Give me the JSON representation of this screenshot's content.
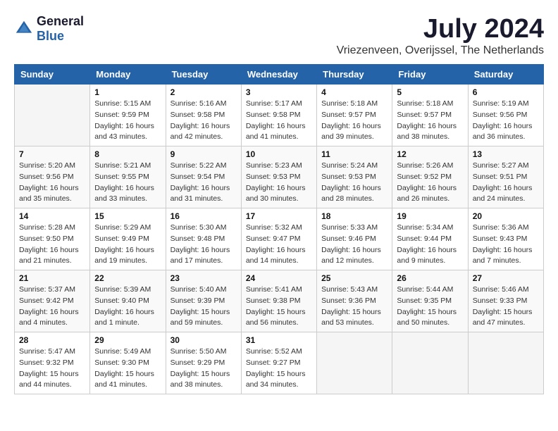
{
  "header": {
    "logo_general": "General",
    "logo_blue": "Blue",
    "title": "July 2024",
    "subtitle": "Vriezenveen, Overijssel, The Netherlands"
  },
  "weekdays": [
    "Sunday",
    "Monday",
    "Tuesday",
    "Wednesday",
    "Thursday",
    "Friday",
    "Saturday"
  ],
  "weeks": [
    [
      {
        "day": "",
        "info": ""
      },
      {
        "day": "1",
        "info": "Sunrise: 5:15 AM\nSunset: 9:59 PM\nDaylight: 16 hours\nand 43 minutes."
      },
      {
        "day": "2",
        "info": "Sunrise: 5:16 AM\nSunset: 9:58 PM\nDaylight: 16 hours\nand 42 minutes."
      },
      {
        "day": "3",
        "info": "Sunrise: 5:17 AM\nSunset: 9:58 PM\nDaylight: 16 hours\nand 41 minutes."
      },
      {
        "day": "4",
        "info": "Sunrise: 5:18 AM\nSunset: 9:57 PM\nDaylight: 16 hours\nand 39 minutes."
      },
      {
        "day": "5",
        "info": "Sunrise: 5:18 AM\nSunset: 9:57 PM\nDaylight: 16 hours\nand 38 minutes."
      },
      {
        "day": "6",
        "info": "Sunrise: 5:19 AM\nSunset: 9:56 PM\nDaylight: 16 hours\nand 36 minutes."
      }
    ],
    [
      {
        "day": "7",
        "info": "Sunrise: 5:20 AM\nSunset: 9:56 PM\nDaylight: 16 hours\nand 35 minutes."
      },
      {
        "day": "8",
        "info": "Sunrise: 5:21 AM\nSunset: 9:55 PM\nDaylight: 16 hours\nand 33 minutes."
      },
      {
        "day": "9",
        "info": "Sunrise: 5:22 AM\nSunset: 9:54 PM\nDaylight: 16 hours\nand 31 minutes."
      },
      {
        "day": "10",
        "info": "Sunrise: 5:23 AM\nSunset: 9:53 PM\nDaylight: 16 hours\nand 30 minutes."
      },
      {
        "day": "11",
        "info": "Sunrise: 5:24 AM\nSunset: 9:53 PM\nDaylight: 16 hours\nand 28 minutes."
      },
      {
        "day": "12",
        "info": "Sunrise: 5:26 AM\nSunset: 9:52 PM\nDaylight: 16 hours\nand 26 minutes."
      },
      {
        "day": "13",
        "info": "Sunrise: 5:27 AM\nSunset: 9:51 PM\nDaylight: 16 hours\nand 24 minutes."
      }
    ],
    [
      {
        "day": "14",
        "info": "Sunrise: 5:28 AM\nSunset: 9:50 PM\nDaylight: 16 hours\nand 21 minutes."
      },
      {
        "day": "15",
        "info": "Sunrise: 5:29 AM\nSunset: 9:49 PM\nDaylight: 16 hours\nand 19 minutes."
      },
      {
        "day": "16",
        "info": "Sunrise: 5:30 AM\nSunset: 9:48 PM\nDaylight: 16 hours\nand 17 minutes."
      },
      {
        "day": "17",
        "info": "Sunrise: 5:32 AM\nSunset: 9:47 PM\nDaylight: 16 hours\nand 14 minutes."
      },
      {
        "day": "18",
        "info": "Sunrise: 5:33 AM\nSunset: 9:46 PM\nDaylight: 16 hours\nand 12 minutes."
      },
      {
        "day": "19",
        "info": "Sunrise: 5:34 AM\nSunset: 9:44 PM\nDaylight: 16 hours\nand 9 minutes."
      },
      {
        "day": "20",
        "info": "Sunrise: 5:36 AM\nSunset: 9:43 PM\nDaylight: 16 hours\nand 7 minutes."
      }
    ],
    [
      {
        "day": "21",
        "info": "Sunrise: 5:37 AM\nSunset: 9:42 PM\nDaylight: 16 hours\nand 4 minutes."
      },
      {
        "day": "22",
        "info": "Sunrise: 5:39 AM\nSunset: 9:40 PM\nDaylight: 16 hours\nand 1 minute."
      },
      {
        "day": "23",
        "info": "Sunrise: 5:40 AM\nSunset: 9:39 PM\nDaylight: 15 hours\nand 59 minutes."
      },
      {
        "day": "24",
        "info": "Sunrise: 5:41 AM\nSunset: 9:38 PM\nDaylight: 15 hours\nand 56 minutes."
      },
      {
        "day": "25",
        "info": "Sunrise: 5:43 AM\nSunset: 9:36 PM\nDaylight: 15 hours\nand 53 minutes."
      },
      {
        "day": "26",
        "info": "Sunrise: 5:44 AM\nSunset: 9:35 PM\nDaylight: 15 hours\nand 50 minutes."
      },
      {
        "day": "27",
        "info": "Sunrise: 5:46 AM\nSunset: 9:33 PM\nDaylight: 15 hours\nand 47 minutes."
      }
    ],
    [
      {
        "day": "28",
        "info": "Sunrise: 5:47 AM\nSunset: 9:32 PM\nDaylight: 15 hours\nand 44 minutes."
      },
      {
        "day": "29",
        "info": "Sunrise: 5:49 AM\nSunset: 9:30 PM\nDaylight: 15 hours\nand 41 minutes."
      },
      {
        "day": "30",
        "info": "Sunrise: 5:50 AM\nSunset: 9:29 PM\nDaylight: 15 hours\nand 38 minutes."
      },
      {
        "day": "31",
        "info": "Sunrise: 5:52 AM\nSunset: 9:27 PM\nDaylight: 15 hours\nand 34 minutes."
      },
      {
        "day": "",
        "info": ""
      },
      {
        "day": "",
        "info": ""
      },
      {
        "day": "",
        "info": ""
      }
    ]
  ]
}
